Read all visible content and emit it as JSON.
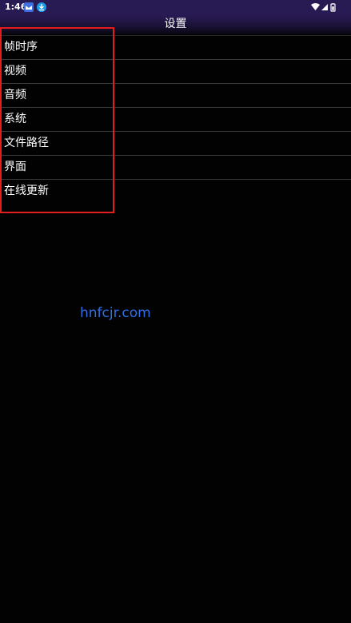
{
  "status_bar": {
    "time": "1:46"
  },
  "app_bar": {
    "title": "设置"
  },
  "settings": {
    "items": [
      {
        "label": "帧时序"
      },
      {
        "label": "视频"
      },
      {
        "label": "音频"
      },
      {
        "label": "系统"
      },
      {
        "label": "文件路径"
      },
      {
        "label": "界面"
      },
      {
        "label": "在线更新"
      }
    ]
  },
  "watermark": {
    "text": "hnfcjr.com"
  },
  "colors": {
    "highlight_box": "#e31c1c",
    "watermark": "#2f6fe8",
    "status_bar": "#281a52"
  }
}
